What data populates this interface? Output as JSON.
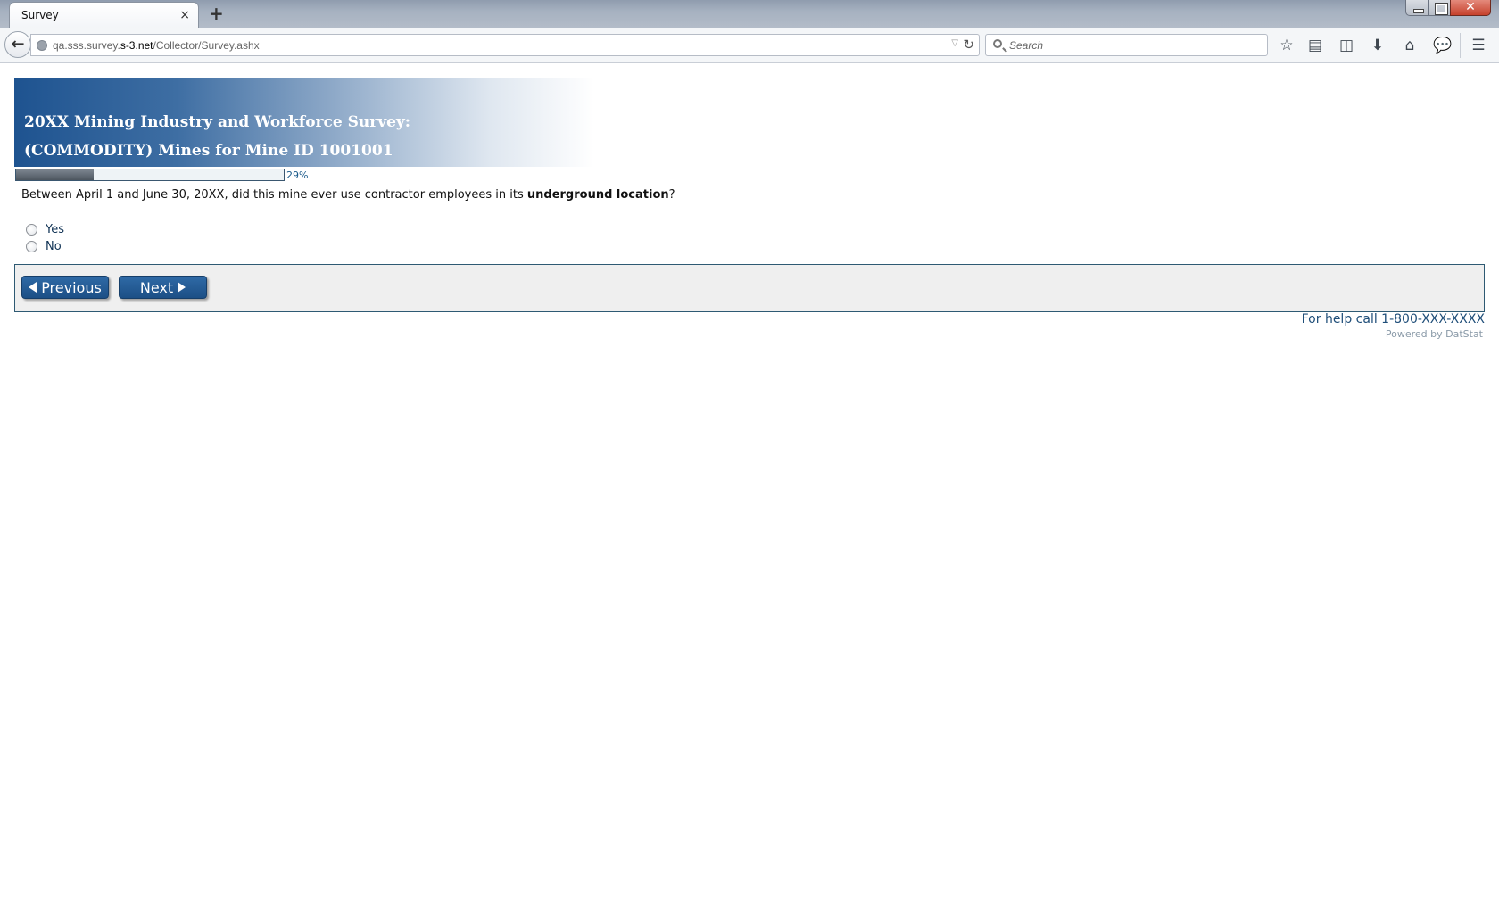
{
  "browser": {
    "tab_title": "Survey",
    "tab_close": "×",
    "new_tab": "+",
    "window_close": "✕",
    "url_base": "qa.sss.survey.",
    "url_host": "s-3.net",
    "url_path": "/Collector/Survey.ashx",
    "search_placeholder": "Search",
    "toolbar_icons": [
      "bookmark-star-icon",
      "reading-list-icon",
      "pocket-icon",
      "download-icon",
      "home-icon",
      "chat-icon",
      "menu-icon"
    ]
  },
  "survey": {
    "title_line1": "20XX Mining Industry and Workforce Survey:",
    "title_line2": "(COMMODITY) Mines for Mine ID 1001001",
    "progress_percent": 29,
    "progress_label": "29%",
    "question_prefix": "Between April 1 and June 30, 20XX, did this mine ever use contractor employees in its ",
    "question_bold": "underground location",
    "question_suffix": "?",
    "options": [
      "Yes",
      "No"
    ],
    "previous_label": "Previous",
    "next_label": "Next",
    "help_text": "For help call 1-800-XXX-XXXX",
    "powered_by": "Powered by DatStat"
  },
  "colors": {
    "banner_dark": "#1e5390",
    "button_blue": "#2f6aa6",
    "panel_border": "#2e5a73",
    "help_text": "#1f4e79"
  }
}
